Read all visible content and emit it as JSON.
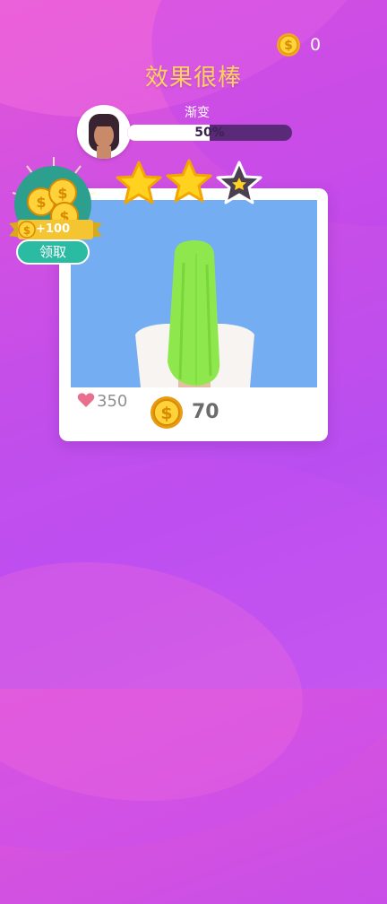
{
  "currency": {
    "amount": "0",
    "icon": "dollar-coin-icon"
  },
  "title": "效果很棒",
  "progress": {
    "label": "渐变",
    "percent_text": "50%",
    "fraction": 0.5
  },
  "rating": {
    "stars_filled": 2,
    "stars_total": 3
  },
  "card": {
    "likes": "350",
    "coins": "70"
  },
  "bonus": {
    "amount": "+100",
    "button": "领取"
  },
  "colors": {
    "title": "#ffd35a",
    "progress_track": "#5a2a78",
    "photo_bg": "#74adf2",
    "hair": "#8ee84d",
    "bonus_button": "#2bbba2",
    "star": "#ffd21f"
  }
}
